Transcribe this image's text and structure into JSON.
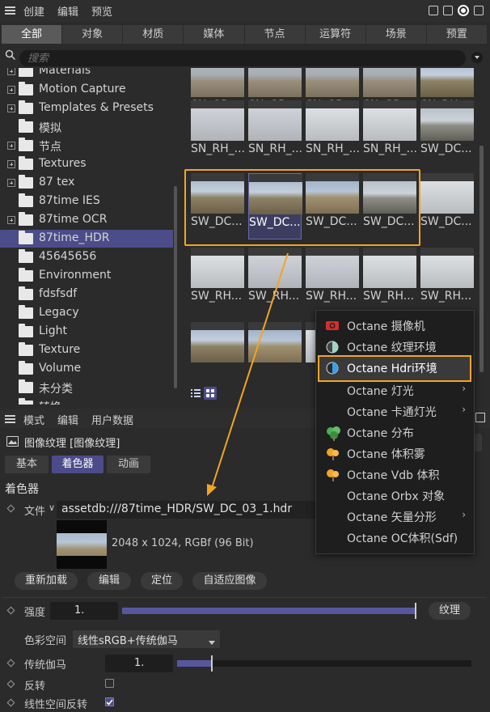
{
  "top_menu": {
    "items": [
      "创建",
      "编辑",
      "预览"
    ]
  },
  "tabs": [
    "全部",
    "对象",
    "材质",
    "媒体",
    "节点",
    "运算符",
    "场景",
    "预置"
  ],
  "active_tab": "全部",
  "search": {
    "placeholder": "搜索"
  },
  "tree": {
    "items": [
      {
        "label": "Materials",
        "expandable": true
      },
      {
        "label": "Motion Capture",
        "expandable": true
      },
      {
        "label": "Templates & Presets",
        "expandable": true
      },
      {
        "label": "模拟",
        "expandable": false
      },
      {
        "label": "节点",
        "expandable": true
      },
      {
        "label": "Textures",
        "expandable": true
      },
      {
        "label": "87 tex",
        "expandable": true
      },
      {
        "label": "87time IES",
        "expandable": false
      },
      {
        "label": "87time OCR",
        "expandable": true
      },
      {
        "label": "87time_HDR",
        "expandable": false,
        "selected": true
      },
      {
        "label": "45645656",
        "expandable": false
      },
      {
        "label": "Environment",
        "expandable": false
      },
      {
        "label": "fdsfsdf",
        "expandable": false
      },
      {
        "label": "Legacy",
        "expandable": false
      },
      {
        "label": "Light",
        "expandable": false
      },
      {
        "label": "Texture",
        "expandable": false
      },
      {
        "label": "Volume",
        "expandable": false
      },
      {
        "label": "未分类",
        "expandable": false
      },
      {
        "label": "转换",
        "expandable": false
      }
    ]
  },
  "grid": {
    "rows": [
      [
        "SN_GD...",
        "SN_GD...",
        "SN_GD...",
        "SN_GD...",
        "SN_RH_..."
      ],
      [
        "SN_RH_...",
        "SN_RH_...",
        "SN_RH_...",
        "SN_RH_...",
        "SW_DC..."
      ],
      [
        "SW_DC...",
        "SW_DC...",
        "SW_DC...",
        "SW_DC...",
        "SW_DC..."
      ],
      [
        "SW_RH...",
        "SW_RH...",
        "SW_RH...",
        "SW_RH...",
        "SW_RH..."
      ],
      [
        "",
        "",
        "",
        "",
        ""
      ]
    ],
    "selected": "SW_DC..."
  },
  "attr_menu": [
    "模式",
    "编辑",
    "用户数据"
  ],
  "attr_title": "图像纹理 [图像纹理]",
  "attr_tabs": [
    "基本",
    "着色器",
    "动画"
  ],
  "attr_active_tab": "着色器",
  "shader_section": "着色器",
  "file": {
    "label": "文件",
    "path": "assetdb:///87time_HDR/SW_DC_03_1.hdr",
    "info": "2048 x 1024, RGBf (96 Bit)"
  },
  "buttons": [
    "重新加载",
    "编辑",
    "定位",
    "自适应图像"
  ],
  "params": {
    "intensity_label": "强度",
    "intensity_value": "1.",
    "intensity_fraction": 1.0,
    "texture_button": "纹理",
    "colorspace_label": "色彩空间",
    "colorspace_value": "线性sRGB+传统伽马",
    "gamma_label": "传统伽马",
    "gamma_value": "1.",
    "gamma_fraction": 0.115,
    "invert_label": "反转",
    "invert_checked": false,
    "linear_invert_label": "线性空间反转",
    "linear_invert_checked": true
  },
  "popup": {
    "items": [
      {
        "label": "Octane 摄像机",
        "icon": "camera-icon",
        "submenu": false
      },
      {
        "label": "Octane 纹理环境",
        "icon": "half-circle-icon",
        "submenu": false
      },
      {
        "label": "Octane Hdri环境",
        "icon": "half-circle-blue-icon",
        "submenu": false,
        "highlighted": true
      },
      {
        "label": "Octane 灯光",
        "icon": "",
        "submenu": true
      },
      {
        "label": "Octane 卡通灯光",
        "icon": "",
        "submenu": true
      },
      {
        "label": "Octane 分布",
        "icon": "tree-icon",
        "submenu": false
      },
      {
        "label": "Octane 体积雾",
        "icon": "fog-icon",
        "submenu": false
      },
      {
        "label": "Octane Vdb 体积",
        "icon": "vdb-icon",
        "submenu": false
      },
      {
        "label": "Octane Orbx 对象",
        "icon": "",
        "submenu": false
      },
      {
        "label": "Octane 矢量分形",
        "icon": "",
        "submenu": true
      },
      {
        "label": "Octane OC体积(Sdf)",
        "icon": "",
        "submenu": false
      }
    ]
  },
  "colors": {
    "accent": "#4c4c8a",
    "highlight_orange": "#f0a623",
    "background": "#2b2b2b"
  }
}
